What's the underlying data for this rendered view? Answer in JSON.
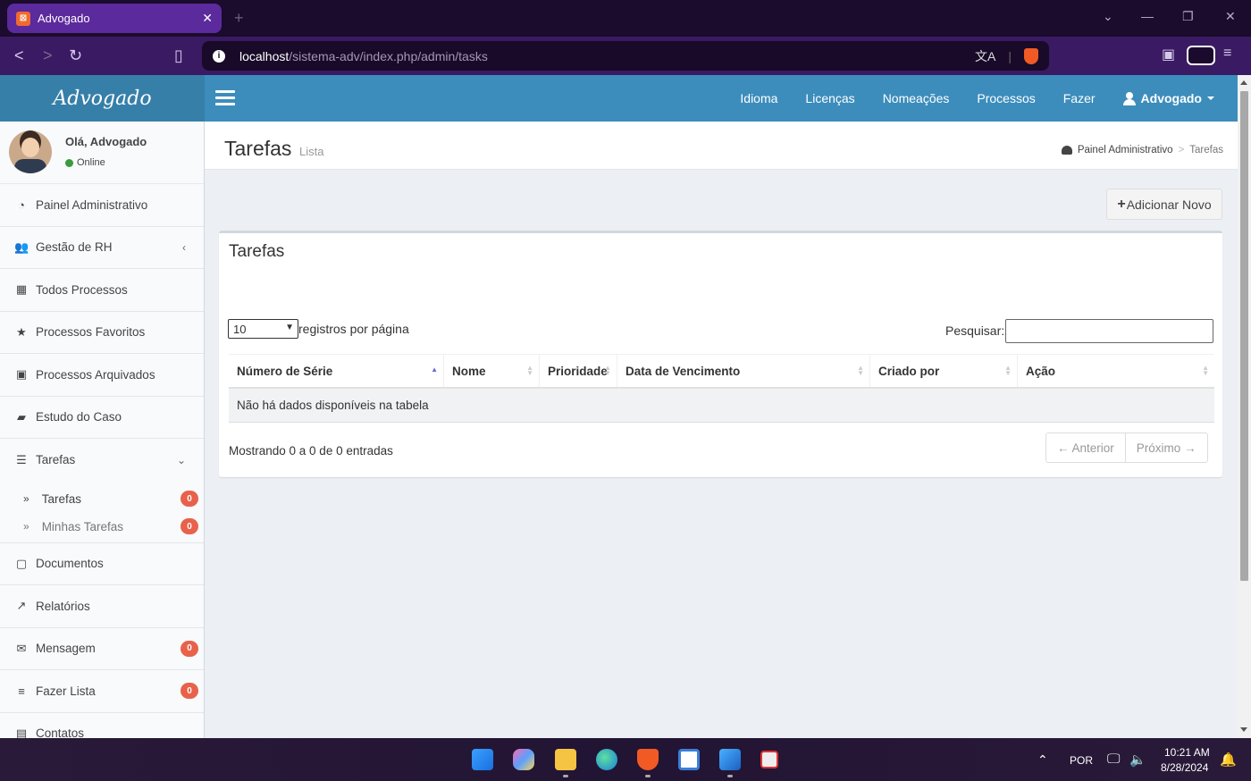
{
  "browser": {
    "tab_title": "Advogado",
    "tab_favicon": "xampp-icon",
    "url_host": "localhost",
    "url_path": "/sistema-adv/index.php/admin/tasks"
  },
  "app": {
    "logo": "Advogado",
    "nav": [
      "Idioma",
      "Licenças",
      "Nomeações",
      "Processos",
      "Fazer"
    ],
    "user_menu": "Advogado"
  },
  "user_panel": {
    "greeting": "Olá, Advogado",
    "status": "Online"
  },
  "sidebar": {
    "items": [
      {
        "label": "Painel Administrativo",
        "icon": "dashboard-icon"
      },
      {
        "label": "Gestão de RH",
        "icon": "users-icon"
      },
      {
        "label": "Todos Processos",
        "icon": "grid-icon"
      },
      {
        "label": "Processos Favoritos",
        "icon": "star-icon"
      },
      {
        "label": "Processos Arquivados",
        "icon": "archive-icon"
      },
      {
        "label": "Estudo do Caso",
        "icon": "book-icon"
      },
      {
        "label": "Tarefas",
        "icon": "tasks-icon"
      },
      {
        "label": "Documentos",
        "icon": "file-icon"
      },
      {
        "label": "Relatórios",
        "icon": "chart-icon"
      },
      {
        "label": "Mensagem",
        "icon": "envelope-icon",
        "badge": "0"
      },
      {
        "label": "Fazer Lista",
        "icon": "list-icon",
        "badge": "0"
      },
      {
        "label": "Contatos",
        "icon": "contacts-icon"
      }
    ],
    "submenu": [
      {
        "label": "Tarefas",
        "badge": "0"
      },
      {
        "label": "Minhas Tarefas",
        "badge": "0"
      }
    ]
  },
  "header": {
    "title": "Tarefas",
    "subtitle": "Lista",
    "breadcrumb_home": "Painel Administrativo",
    "breadcrumb_sep": ">",
    "breadcrumb_current": "Tarefas"
  },
  "actions": {
    "add_label": "Adicionar Novo"
  },
  "box": {
    "title": "Tarefas",
    "page_length": "10",
    "length_label": "registros por página",
    "search_label": "Pesquisar:",
    "columns": [
      "Número de Série",
      "Nome",
      "Prioridade",
      "Data de Vencimento",
      "Criado por",
      "Ação"
    ],
    "empty_text": "Não há dados disponíveis na tabela",
    "info": "Mostrando 0 a 0 de 0 entradas",
    "prev": "← Anterior",
    "next": "Próximo →"
  },
  "taskbar": {
    "lang": "POR",
    "time": "10:21 AM",
    "date": "8/28/2024"
  }
}
